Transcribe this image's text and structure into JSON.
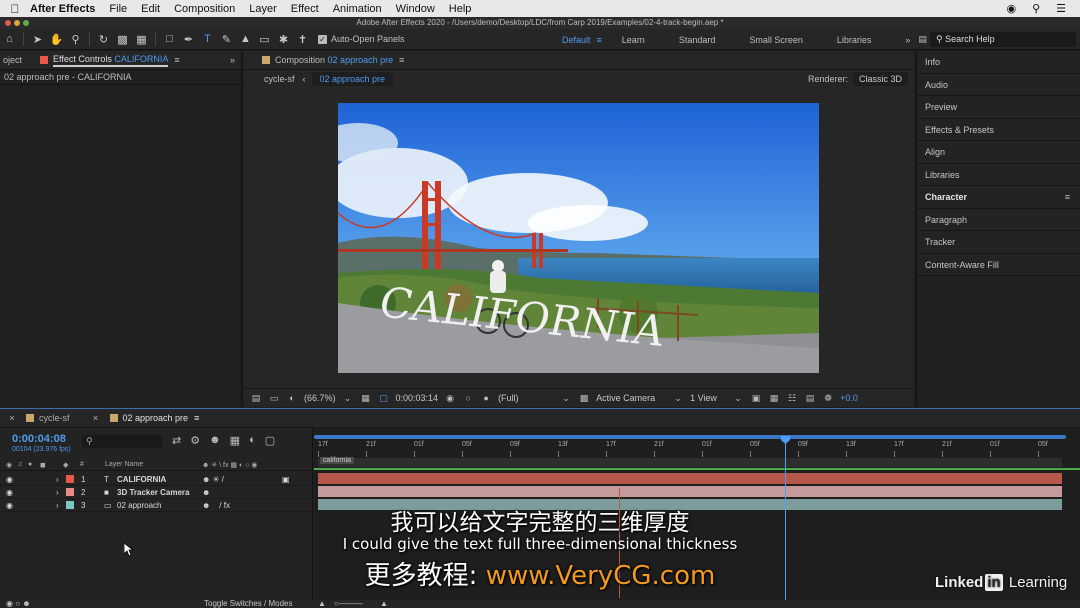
{
  "menubar": {
    "app_name": "After Effects",
    "items": [
      "File",
      "Edit",
      "Composition",
      "Layer",
      "Effect",
      "Animation",
      "Window",
      "Help"
    ]
  },
  "title": "Adobe After Effects 2020 - /Users/demo/Desktop/LDC/from Carp 2019/Examples/02-4-track-begin.aep *",
  "toolbar": {
    "auto_open_panels": "Auto-Open Panels",
    "workspaces": [
      "Default",
      "Learn",
      "Standard",
      "Small Screen",
      "Libraries"
    ],
    "active_workspace": "Default",
    "search_help": "Search Help"
  },
  "left_panel": {
    "tab_project": "oject",
    "tab_effect_prefix": "Effect Controls",
    "tab_effect_layer": "CALIFORNIA",
    "sub_label": "02 approach pre - CALIFORNIA"
  },
  "comp_panel": {
    "tab_prefix": "Composition",
    "tab_name": "02 approach pre",
    "crumb_parent": "cycle-sf",
    "crumb_current": "02 approach pre",
    "renderer_label": "Renderer:",
    "renderer_value": "Classic 3D",
    "overlay_text": "CALIFORNIA"
  },
  "viewer_bar": {
    "zoom": "(66.7%)",
    "timecode": "0:00:03:14",
    "resolution": "(Full)",
    "camera": "Active Camera",
    "view": "1 View",
    "exposure": "+0.0"
  },
  "right_panel": {
    "items": [
      "Info",
      "Audio",
      "Preview",
      "Effects & Presets",
      "Align",
      "Libraries",
      "Character",
      "Paragraph",
      "Tracker",
      "Content-Aware Fill"
    ]
  },
  "timeline": {
    "tabs": [
      "cycle-sf",
      "02 approach pre"
    ],
    "timecode": "0:00:04:08",
    "fps": "00104 (23.976 fps)",
    "search_placeholder": "",
    "col_num": "#",
    "col_layer_name": "Layer Name",
    "layers": [
      {
        "num": "1",
        "type": "T",
        "name": "CALIFORNIA",
        "color": "#e8584a"
      },
      {
        "num": "2",
        "type": "■",
        "name": "3D Tracker Camera",
        "color": "#e88a8a"
      },
      {
        "num": "3",
        "type": "▭",
        "name": "02 approach",
        "color": "#7ec6c6"
      }
    ],
    "ruler_ticks": [
      "17f",
      "21f",
      "01f",
      "05f",
      "09f",
      "13f",
      "17f",
      "21f",
      "01f",
      "05f",
      "09f",
      "13f",
      "17f",
      "21f",
      "01f",
      "05f"
    ],
    "marker_label": "california",
    "footer_toggle": "Toggle Switches / Modes"
  },
  "subtitles": {
    "zh": "我可以给文字完整的三维厚度",
    "en": "I could give the text full three-dimensional thickness",
    "promo_prefix": "更多教程:",
    "promo_url": "www.VeryCG.com"
  },
  "watermark": {
    "linked": "Linked",
    "in": "in",
    "learning": "Learning"
  }
}
